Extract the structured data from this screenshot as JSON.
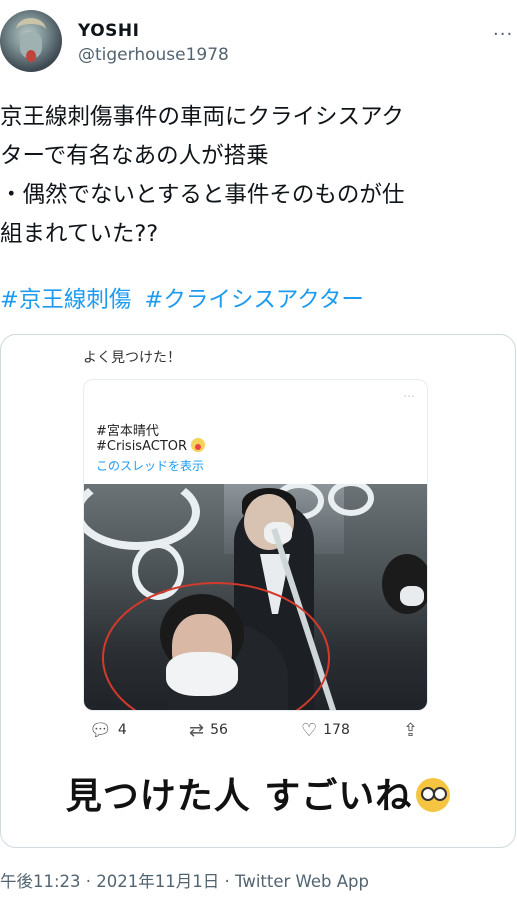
{
  "header": {
    "display_name": "YOSHI",
    "handle": "@tigerhouse1978",
    "more": "···"
  },
  "tweet": {
    "text": "京王線刺傷事件の車両にクライシスアク\nターで有名なあの人が搭乗\n・偶然でないとすると事件そのものが仕\n組まれていた??",
    "hashtags": [
      "#京王線刺傷",
      "#クライシスアクター"
    ]
  },
  "media": {
    "top_text": "よく見つけた！",
    "inner_tweet": {
      "hashtag1": "#宮本晴代",
      "hashtag2": "#CrisisACTOR",
      "show_thread": "このスレッドを表示"
    },
    "actions": {
      "reply_count": "4",
      "retweet_count": "56",
      "like_count": "178"
    },
    "caption": "見つけた人 すごいね"
  },
  "footer": {
    "timestamp": "午後11:23 · 2021年11月1日 · Twitter Web App"
  },
  "colors": {
    "link": "#1d9bf0",
    "secondary": "#536471",
    "circle": "#d33a2c"
  }
}
